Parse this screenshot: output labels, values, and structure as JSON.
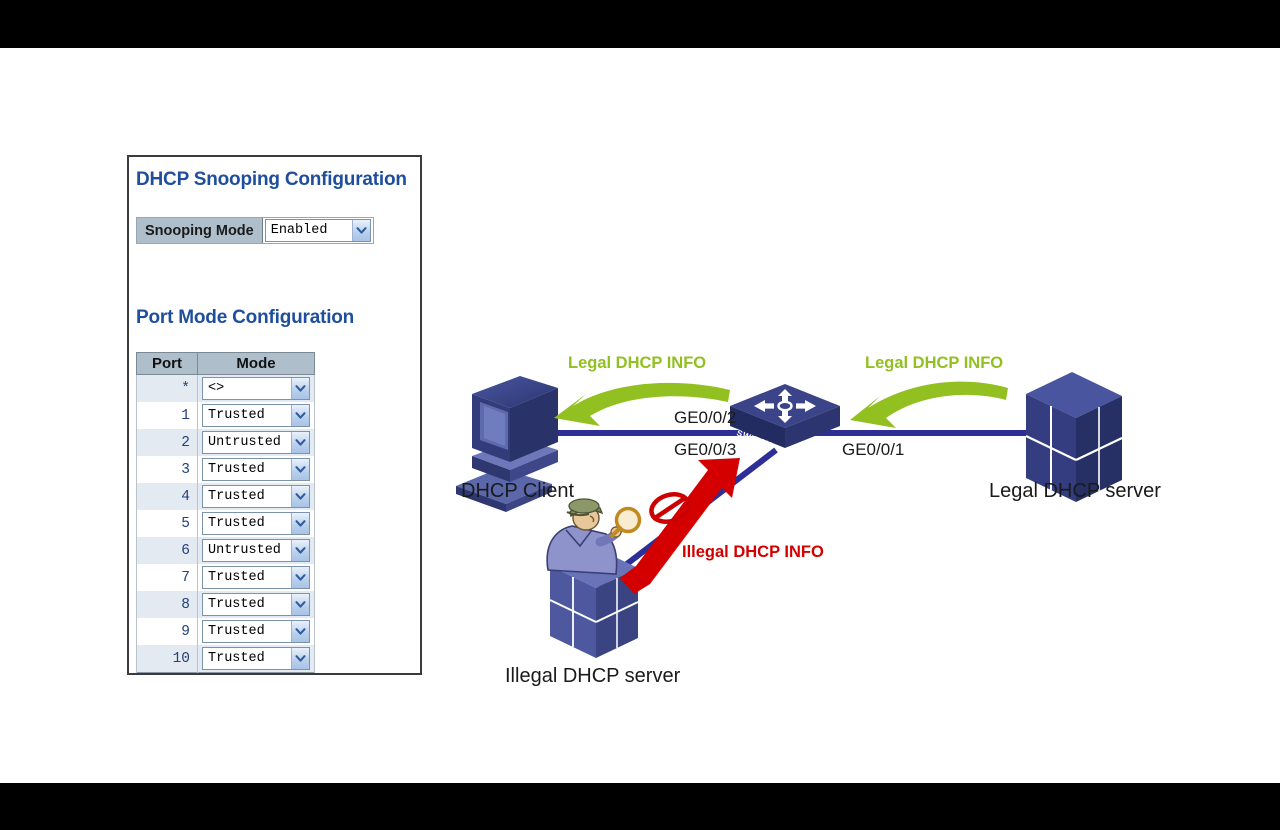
{
  "slide": {
    "background": "#ffffff",
    "letterbox_color": "#000000"
  },
  "config_panel": {
    "snooping_title": "DHCP Snooping Configuration",
    "snooping_mode_label": "Snooping Mode",
    "snooping_mode_value": "Enabled",
    "port_mode_title": "Port Mode Configuration",
    "table": {
      "headers": [
        "Port",
        "Mode"
      ],
      "rows": [
        {
          "port": "*",
          "mode": "<>"
        },
        {
          "port": "1",
          "mode": "Trusted"
        },
        {
          "port": "2",
          "mode": "Untrusted"
        },
        {
          "port": "3",
          "mode": "Trusted"
        },
        {
          "port": "4",
          "mode": "Trusted"
        },
        {
          "port": "5",
          "mode": "Trusted"
        },
        {
          "port": "6",
          "mode": "Untrusted"
        },
        {
          "port": "7",
          "mode": "Trusted"
        },
        {
          "port": "8",
          "mode": "Trusted"
        },
        {
          "port": "9",
          "mode": "Trusted"
        },
        {
          "port": "10",
          "mode": "Trusted"
        }
      ]
    }
  },
  "diagram": {
    "nodes": {
      "client": "DHCP Client",
      "switch": "SWITCH",
      "legal_server": "Legal DHCP server",
      "illegal_server": "Illegal DHCP server"
    },
    "ports": {
      "to_client": "GE0/0/2",
      "to_illegal": "GE0/0/3",
      "to_legal": "GE0/0/1"
    },
    "flows": {
      "legal_left": "Legal DHCP INFO",
      "legal_right": "Legal DHCP INFO",
      "illegal": "Illegal  DHCP INFO"
    },
    "colors": {
      "legal_arrow": "#92c020",
      "illegal_arrow": "#d40000",
      "link_line": "#2d2f96",
      "device_navy": "#2f3d78",
      "title_blue": "#1f4e9c",
      "header_grey_blue": "#aebfcb"
    }
  }
}
